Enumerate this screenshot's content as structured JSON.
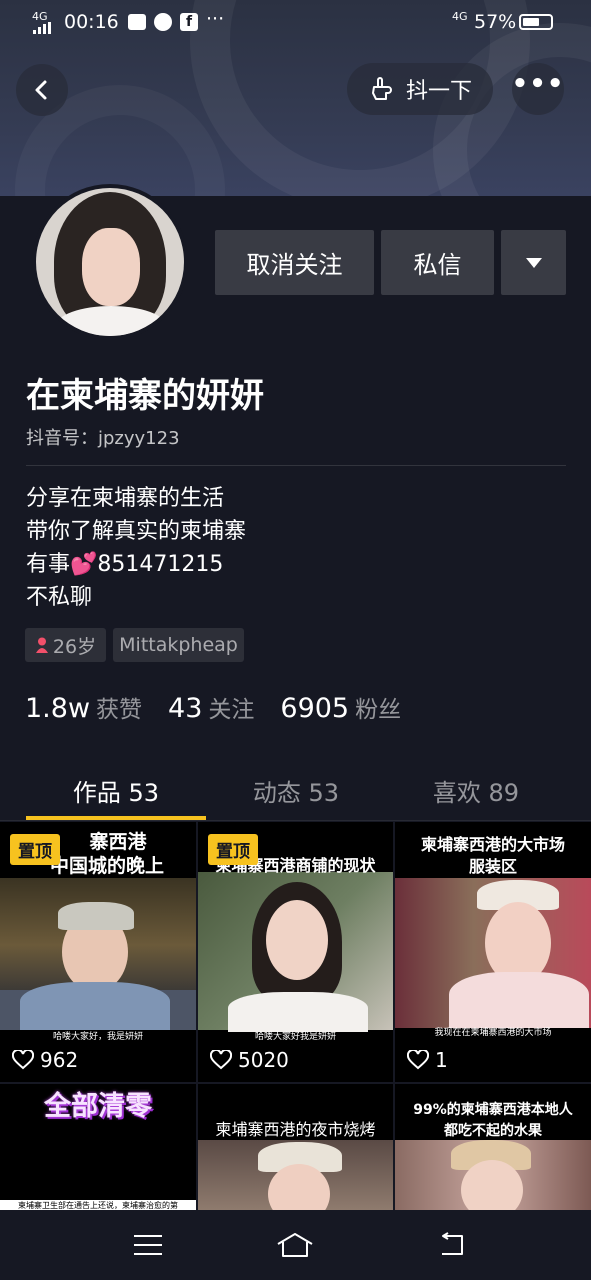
{
  "status": {
    "network": "4G",
    "time": "00:16",
    "network_right": "4G",
    "battery": "57%"
  },
  "header": {
    "poke_label": "抖一下"
  },
  "profile": {
    "unfollow_label": "取消关注",
    "message_label": "私信",
    "name": "在柬埔寨的妍妍",
    "douyin_id": "抖音号：jpzyy123",
    "bio": [
      "分享在柬埔寨的生活",
      "带你了解真实的柬埔寨",
      "有事💕851471215",
      "不私聊"
    ],
    "tags": {
      "age": "26岁",
      "location": "Mittakpheap"
    },
    "stats": [
      {
        "value": "1.8w",
        "label": "获赞"
      },
      {
        "value": "43",
        "label": "关注"
      },
      {
        "value": "6905",
        "label": "粉丝"
      }
    ]
  },
  "tabs": [
    {
      "label": "作品 53",
      "active": true
    },
    {
      "label": "动态 53",
      "active": false
    },
    {
      "label": "喜欢 89",
      "active": false
    }
  ],
  "videos": [
    {
      "pin": "置顶",
      "title_line1": "寨西港",
      "title_line2": "中国城的晚上",
      "subtitle": "哈喽大家好，我是妍妍",
      "likes": "962"
    },
    {
      "pin": "置顶",
      "title_line1": "柬埔寨西港商铺的现状",
      "title_line2": "",
      "subtitle": "哈喽大家好我是妍妍",
      "likes": "5020"
    },
    {
      "pin": "",
      "title_line1": "柬埔寨西港的大市场",
      "title_line2": "服装区",
      "subtitle": "我现在在柬埔寨西港的大市场",
      "likes": "1"
    },
    {
      "pin": "",
      "title_line1": "全部清零",
      "title_line2": "",
      "subtitle": "柬埔寨卫生部在通告上还说，柬埔寨治愈的第",
      "likes": ""
    },
    {
      "pin": "",
      "title_line1": "柬埔寨西港的夜市烧烤",
      "title_line2": "",
      "subtitle": "",
      "likes": ""
    },
    {
      "pin": "",
      "title_line1": "99%的柬埔寨西港本地人",
      "title_line2": "都吃不起的水果",
      "subtitle": "",
      "likes": ""
    }
  ],
  "colors": {
    "background": "#161823",
    "accent": "#f7c21f",
    "button": "#393b44"
  }
}
